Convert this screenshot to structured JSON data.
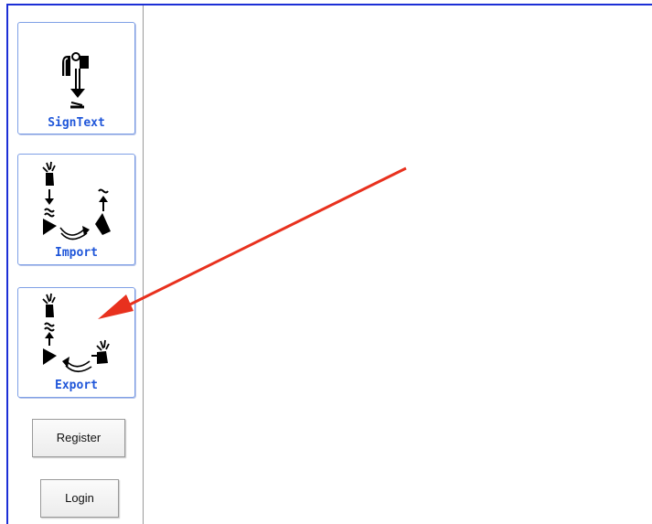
{
  "sidebar": {
    "tools": [
      {
        "label": "SignText",
        "icon": "signtext-icon"
      },
      {
        "label": "Import",
        "icon": "import-icon"
      },
      {
        "label": "Export",
        "icon": "export-icon"
      }
    ],
    "register_label": "Register",
    "login_label": "Login"
  },
  "colors": {
    "frame": "#1c2fd6",
    "label": "#1f56d9",
    "arrow": "#e8311e"
  }
}
